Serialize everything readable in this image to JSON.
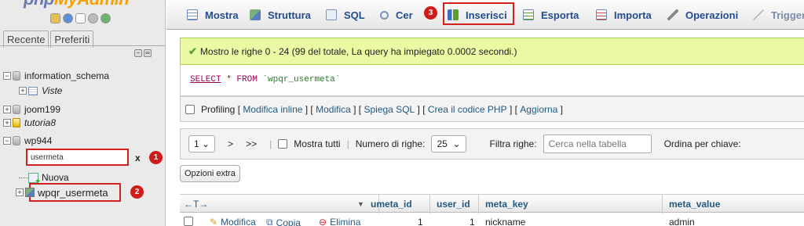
{
  "sidebar": {
    "logo_main": "php",
    "logo_accent": "MyAdmin",
    "tab_recent": "Recente",
    "tab_favorites": "Preferiti",
    "tree": {
      "information_schema": "information_schema",
      "viste": "Viste",
      "joom199": "joom199",
      "tutoria8": "tutoria8",
      "wp944": "wp944",
      "filter_value": "usermeta",
      "clear": "x",
      "nuova": "Nuova",
      "table": "wpqr_usermeta"
    },
    "badges": {
      "b1": "1",
      "b2": "2"
    }
  },
  "tabs": {
    "mostra": "Mostra",
    "struttura": "Struttura",
    "sql": "SQL",
    "cerca": "Cer",
    "badge3": "3",
    "inserisci": "Inserisci",
    "esporta": "Esporta",
    "importa": "Importa",
    "operazioni": "Operazioni",
    "trigger": "Trigger"
  },
  "notice": "Mostro le righe 0 - 24 (99 del totale, La query ha impiegato 0.0002 secondi.)",
  "sql": {
    "select": "SELECT",
    "star": " * ",
    "from": "FROM",
    "table": " `wpqr_usermeta`"
  },
  "profiling": {
    "label": "Profiling",
    "open": " [ ",
    "close": " ]",
    "links": [
      "Modifica inline",
      "Modifica",
      "Spiega SQL",
      "Crea il codice PHP",
      "Aggiorna"
    ]
  },
  "nav": {
    "page": "1",
    "next": ">",
    "last": ">>",
    "show_all": "Mostra tutti",
    "rows_label": "Numero di righe:",
    "rows_value": "25",
    "filter_label": "Filtra righe:",
    "filter_placeholder": "Cerca nella tabella",
    "order_label": "Ordina per chiave:"
  },
  "extra_options": "Opzioni extra",
  "table": {
    "columns": [
      "umeta_id",
      "user_id",
      "meta_key",
      "meta_value"
    ],
    "row": {
      "edit": "Modifica",
      "copy": "Copia",
      "delete": "Elimina",
      "umeta_id": "1",
      "user_id": "1",
      "meta_key": "nickname",
      "meta_value": "admin"
    }
  },
  "colors": {
    "accent_red": "#d02020",
    "link": "#235a81",
    "notice_bg": "#ebf8a4"
  }
}
